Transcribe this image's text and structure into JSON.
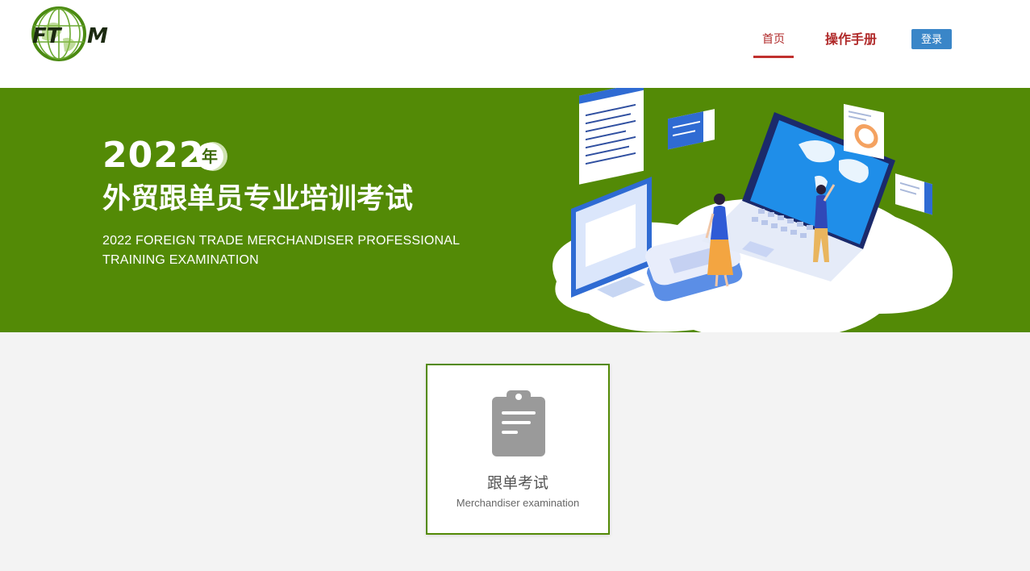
{
  "header": {
    "logo_text": "FTM",
    "nav": {
      "home_label": "首页",
      "manual_label": "操作手册",
      "login_label": "登录"
    }
  },
  "banner": {
    "year": "2022",
    "year_badge": "年",
    "title_cn": "外贸跟单员专业培训考试",
    "title_en_line1": "2022 FOREIGN TRADE MERCHANDISER  PROFESSIONAL",
    "title_en_line2": "TRAINING EXAMINATION"
  },
  "exam_card": {
    "title": "跟单考试",
    "subtitle": "Merchandiser examination",
    "icon": "clipboard-icon"
  },
  "colors": {
    "brand_green": "#538a06",
    "nav_red": "#b02a2a",
    "login_blue": "#3a86c8",
    "page_bg": "#f3f3f3"
  }
}
